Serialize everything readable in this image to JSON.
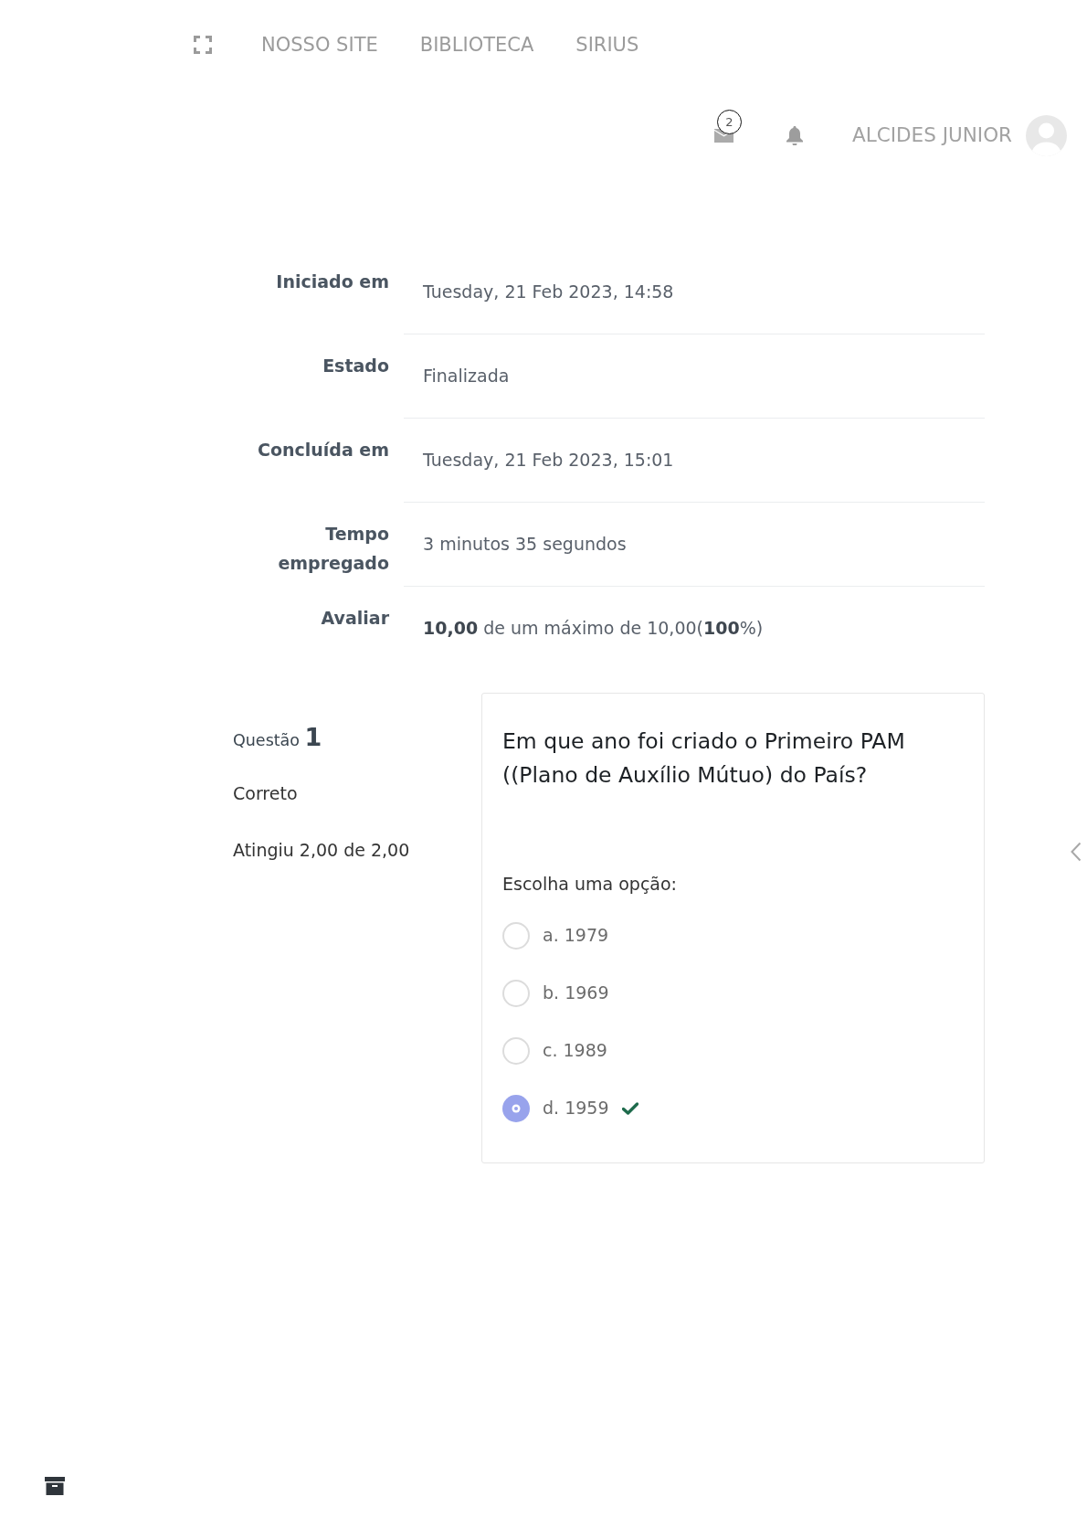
{
  "nav": {
    "links": [
      "NOSSO SITE",
      "BIBLIOTECA",
      "SIRIUS"
    ]
  },
  "user_bar": {
    "message_count": "2",
    "user_name": "ALCIDES JUNIOR"
  },
  "summary": [
    {
      "label": "Iniciado em",
      "value": "Tuesday, 21 Feb 2023, 14:58"
    },
    {
      "label": "Estado",
      "value": "Finalizada"
    },
    {
      "label": "Concluída em",
      "value": "Tuesday, 21 Feb 2023, 15:01"
    },
    {
      "label": "Tempo empregado",
      "value": "3 minutos 35 segundos"
    },
    {
      "label": "Avaliar",
      "value": "**10,00** de um máximo de 10,00(**100**%)"
    }
  ],
  "question": {
    "title": "Questão **1**",
    "status": "Correto",
    "grade": "Atingiu 2,00 de 2,00",
    "text": "Em que ano foi criado o Primeiro PAM ((Plano de Auxílio Mútuo) do País?",
    "prompt": "Escolha uma opção:",
    "options": [
      {
        "label": "a. 1979",
        "selected": false,
        "correct": false
      },
      {
        "label": "b. 1969",
        "selected": false,
        "correct": false
      },
      {
        "label": "c. 1989",
        "selected": false,
        "correct": false
      },
      {
        "label": "d. 1959",
        "selected": true,
        "correct": true
      }
    ]
  }
}
